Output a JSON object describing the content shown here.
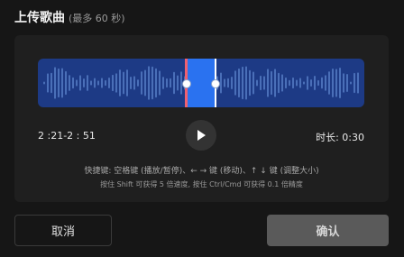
{
  "header": {
    "title": "上传歌曲",
    "subtitle": "(最多 60 秒)"
  },
  "player": {
    "range_text": "2 :21-2 : 51",
    "duration_text": "时长: 0:30",
    "play_icon": "play-icon"
  },
  "hints": {
    "line1": "快捷键: 空格键 (播放/暂停)、← → 键 (移动)、↑ ↓ 键 (调整大小)",
    "line2": "按住 Shift 可获得 5 倍速度, 按住 Ctrl/Cmd 可获得 0.1 倍精度"
  },
  "buttons": {
    "cancel": "取消",
    "confirm": "确认"
  },
  "colors": {
    "waveform_bg": "#1d3a85",
    "selection": "#2a72f0",
    "left_edge": "#f06070",
    "right_edge": "#ffffff"
  }
}
